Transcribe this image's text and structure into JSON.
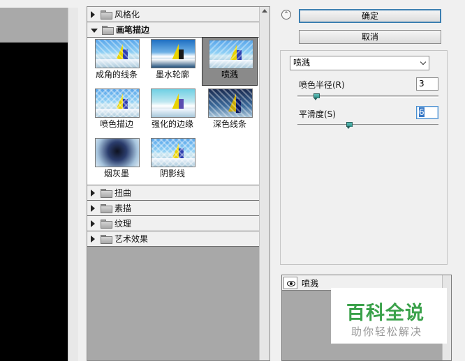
{
  "gallery": {
    "categories_top": [
      {
        "label": "风格化",
        "state": "collapsed"
      },
      {
        "label": "画笔描边",
        "state": "expanded"
      }
    ],
    "thumbnails": [
      {
        "label": "成角的线条",
        "selected": false
      },
      {
        "label": "墨水轮廓",
        "selected": false
      },
      {
        "label": "喷溅",
        "selected": true
      },
      {
        "label": "喷色描边",
        "selected": false
      },
      {
        "label": "强化的边缘",
        "selected": false
      },
      {
        "label": "深色线条",
        "selected": false
      },
      {
        "label": "烟灰墨",
        "selected": false
      },
      {
        "label": "阴影线",
        "selected": false
      }
    ],
    "categories_bottom": [
      {
        "label": "扭曲",
        "state": "collapsed"
      },
      {
        "label": "素描",
        "state": "collapsed"
      },
      {
        "label": "纹理",
        "state": "collapsed"
      },
      {
        "label": "艺术效果",
        "state": "collapsed"
      }
    ]
  },
  "controls": {
    "ok_label": "确定",
    "cancel_label": "取消",
    "filter_select_value": "喷溅",
    "params": [
      {
        "label": "喷色半径(R)",
        "value": "3",
        "slider_fraction": 0.13
      },
      {
        "label": "平滑度(S)",
        "value": "6",
        "slider_fraction": 0.36
      }
    ]
  },
  "layers": {
    "items": [
      {
        "name": "喷溅",
        "visible": true
      }
    ]
  },
  "watermark": {
    "logo": "百科全说",
    "sub": "助你轻松解决"
  },
  "icons": {
    "collapse": "double-chevron-up-icon",
    "folder": "folder-icon",
    "eye": "eye-icon",
    "dropdown": "chevron-down-icon"
  },
  "colors": {
    "ok_border": "#3c7fb1",
    "slider_thumb": "#2e8d86",
    "watermark_green": "#3aa14a"
  }
}
